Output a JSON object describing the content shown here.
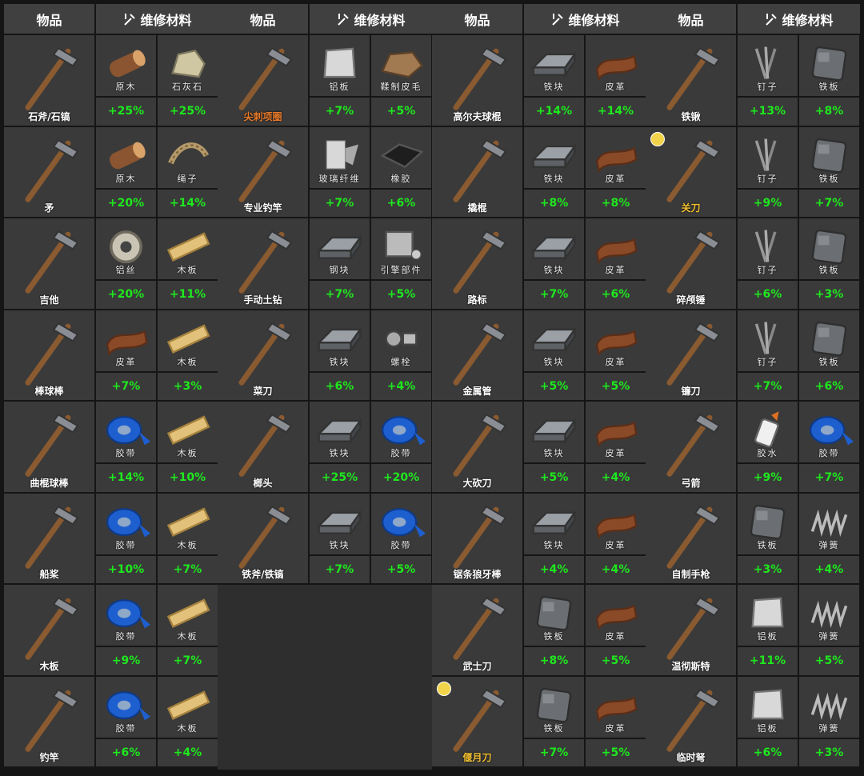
{
  "headers": {
    "item": "物品",
    "repair": "维修材料"
  },
  "columns": [
    [
      {
        "name": "石斧/石镐",
        "icon": "stone-axe-pickaxe-icon",
        "mats": [
          {
            "name": "原木",
            "pct": "+25%",
            "icon": "log-icon"
          },
          {
            "name": "石灰石",
            "pct": "+25%",
            "icon": "limestone-icon"
          }
        ]
      },
      {
        "name": "矛",
        "icon": "spear-icon",
        "mats": [
          {
            "name": "原木",
            "pct": "+20%",
            "icon": "log-icon"
          },
          {
            "name": "绳子",
            "pct": "+14%",
            "icon": "rope-icon"
          }
        ]
      },
      {
        "name": "吉他",
        "icon": "guitar-icon",
        "mats": [
          {
            "name": "铝丝",
            "pct": "+20%",
            "icon": "wire-icon"
          },
          {
            "name": "木板",
            "pct": "+11%",
            "icon": "plank-icon"
          }
        ]
      },
      {
        "name": "棒球棒",
        "icon": "baseball-bat-icon",
        "mats": [
          {
            "name": "皮革",
            "pct": "+7%",
            "icon": "leather-icon"
          },
          {
            "name": "木板",
            "pct": "+3%",
            "icon": "plank-icon"
          }
        ]
      },
      {
        "name": "曲棍球棒",
        "icon": "hockey-stick-icon",
        "mats": [
          {
            "name": "胶带",
            "pct": "+14%",
            "icon": "tape-icon"
          },
          {
            "name": "木板",
            "pct": "+10%",
            "icon": "plank-icon"
          }
        ]
      },
      {
        "name": "船桨",
        "icon": "paddle-icon",
        "mats": [
          {
            "name": "胶带",
            "pct": "+10%",
            "icon": "tape-icon"
          },
          {
            "name": "木板",
            "pct": "+7%",
            "icon": "plank-icon"
          }
        ]
      },
      {
        "name": "木板",
        "icon": "wooden-plank-weapon-icon",
        "mats": [
          {
            "name": "胶带",
            "pct": "+9%",
            "icon": "tape-icon"
          },
          {
            "name": "木板",
            "pct": "+7%",
            "icon": "plank-icon"
          }
        ]
      },
      {
        "name": "钓竿",
        "icon": "fishing-rod-icon",
        "mats": [
          {
            "name": "胶带",
            "pct": "+6%",
            "icon": "tape-icon"
          },
          {
            "name": "木板",
            "pct": "+4%",
            "icon": "plank-icon"
          }
        ]
      }
    ],
    [
      {
        "name": "尖刺项圈",
        "nameColor": "orange",
        "icon": "spiked-collar-icon",
        "mats": [
          {
            "name": "铝板",
            "pct": "+7%",
            "icon": "aluminum-sheet-icon"
          },
          {
            "name": "鞣制皮毛",
            "pct": "+5%",
            "icon": "tanned-fur-icon"
          }
        ]
      },
      {
        "name": "专业钓竿",
        "icon": "pro-fishing-rod-icon",
        "mats": [
          {
            "name": "玻璃纤维",
            "pct": "+7%",
            "icon": "fiberglass-icon"
          },
          {
            "name": "橡胶",
            "pct": "+6%",
            "icon": "rubber-icon"
          }
        ]
      },
      {
        "name": "手动土钻",
        "icon": "auger-icon",
        "mats": [
          {
            "name": "钢块",
            "pct": "+7%",
            "icon": "steel-ingot-icon"
          },
          {
            "name": "引擎部件",
            "pct": "+5%",
            "icon": "engine-part-icon"
          }
        ]
      },
      {
        "name": "菜刀",
        "icon": "cleaver-icon",
        "mats": [
          {
            "name": "铁块",
            "pct": "+6%",
            "icon": "iron-ingot-icon"
          },
          {
            "name": "螺栓",
            "pct": "+4%",
            "icon": "bolt-icon"
          }
        ]
      },
      {
        "name": "榔头",
        "icon": "hammer-icon",
        "mats": [
          {
            "name": "铁块",
            "pct": "+25%",
            "icon": "iron-ingot-icon"
          },
          {
            "name": "胶带",
            "pct": "+20%",
            "icon": "tape-icon"
          }
        ]
      },
      {
        "name": "铁斧/铁镐",
        "icon": "iron-axe-pickaxe-icon",
        "mats": [
          {
            "name": "铁块",
            "pct": "+7%",
            "icon": "iron-ingot-icon"
          },
          {
            "name": "胶带",
            "pct": "+5%",
            "icon": "tape-icon"
          }
        ]
      }
    ],
    [
      {
        "name": "高尔夫球棍",
        "icon": "golf-club-icon",
        "mats": [
          {
            "name": "铁块",
            "pct": "+14%",
            "icon": "iron-ingot-icon"
          },
          {
            "name": "皮革",
            "pct": "+14%",
            "icon": "leather-icon"
          }
        ]
      },
      {
        "name": "撬棍",
        "icon": "crowbar-icon",
        "mats": [
          {
            "name": "铁块",
            "pct": "+8%",
            "icon": "iron-ingot-icon"
          },
          {
            "name": "皮革",
            "pct": "+8%",
            "icon": "leather-icon"
          }
        ]
      },
      {
        "name": "路标",
        "icon": "road-sign-icon",
        "mats": [
          {
            "name": "铁块",
            "pct": "+7%",
            "icon": "iron-ingot-icon"
          },
          {
            "name": "皮革",
            "pct": "+6%",
            "icon": "leather-icon"
          }
        ]
      },
      {
        "name": "金属管",
        "icon": "metal-pipe-icon",
        "mats": [
          {
            "name": "铁块",
            "pct": "+5%",
            "icon": "iron-ingot-icon"
          },
          {
            "name": "皮革",
            "pct": "+5%",
            "icon": "leather-icon"
          }
        ]
      },
      {
        "name": "大砍刀",
        "icon": "machete-icon",
        "mats": [
          {
            "name": "铁块",
            "pct": "+5%",
            "icon": "iron-ingot-icon"
          },
          {
            "name": "皮革",
            "pct": "+4%",
            "icon": "leather-icon"
          }
        ]
      },
      {
        "name": "锯条狼牙棒",
        "icon": "saw-mace-icon",
        "mats": [
          {
            "name": "铁块",
            "pct": "+4%",
            "icon": "iron-ingot-icon"
          },
          {
            "name": "皮革",
            "pct": "+4%",
            "icon": "leather-icon"
          }
        ]
      },
      {
        "name": "武士刀",
        "icon": "katana-icon",
        "mats": [
          {
            "name": "铁板",
            "pct": "+8%",
            "icon": "iron-sheet-icon"
          },
          {
            "name": "皮革",
            "pct": "+5%",
            "icon": "leather-icon"
          }
        ]
      },
      {
        "name": "偃月刀",
        "nameColor": "gold",
        "badge": true,
        "icon": "crescent-blade-icon",
        "mats": [
          {
            "name": "铁板",
            "pct": "+7%",
            "icon": "iron-sheet-icon"
          },
          {
            "name": "皮革",
            "pct": "+5%",
            "icon": "leather-icon"
          }
        ]
      }
    ],
    [
      {
        "name": "铁锹",
        "icon": "shovel-icon",
        "mats": [
          {
            "name": "钉子",
            "pct": "+13%",
            "icon": "nails-icon"
          },
          {
            "name": "铁板",
            "pct": "+8%",
            "icon": "iron-sheet-icon"
          }
        ]
      },
      {
        "name": "关刀",
        "nameColor": "gold",
        "badge": true,
        "icon": "guandao-icon",
        "mats": [
          {
            "name": "钉子",
            "pct": "+9%",
            "icon": "nails-icon"
          },
          {
            "name": "铁板",
            "pct": "+7%",
            "icon": "iron-sheet-icon"
          }
        ]
      },
      {
        "name": "碎颅锤",
        "icon": "sledgehammer-icon",
        "mats": [
          {
            "name": "钉子",
            "pct": "+6%",
            "icon": "nails-icon"
          },
          {
            "name": "铁板",
            "pct": "+3%",
            "icon": "iron-sheet-icon"
          }
        ]
      },
      {
        "name": "镰刀",
        "icon": "scythe-icon",
        "mats": [
          {
            "name": "钉子",
            "pct": "+7%",
            "icon": "nails-icon"
          },
          {
            "name": "铁板",
            "pct": "+6%",
            "icon": "iron-sheet-icon"
          }
        ]
      },
      {
        "name": "弓箭",
        "icon": "bow-icon",
        "mats": [
          {
            "name": "胶水",
            "pct": "+9%",
            "icon": "glue-icon"
          },
          {
            "name": "胶带",
            "pct": "+7%",
            "icon": "tape-icon"
          }
        ]
      },
      {
        "name": "自制手枪",
        "icon": "homemade-pistol-icon",
        "mats": [
          {
            "name": "铁板",
            "pct": "+3%",
            "icon": "iron-sheet-icon"
          },
          {
            "name": "弹簧",
            "pct": "+4%",
            "icon": "spring-icon"
          }
        ]
      },
      {
        "name": "温彻斯特",
        "icon": "winchester-icon",
        "mats": [
          {
            "name": "铝板",
            "pct": "+11%",
            "icon": "aluminum-sheet-icon"
          },
          {
            "name": "弹簧",
            "pct": "+5%",
            "icon": "spring-icon"
          }
        ]
      },
      {
        "name": "临时弩",
        "icon": "crossbow-icon",
        "mats": [
          {
            "name": "铝板",
            "pct": "+6%",
            "icon": "aluminum-sheet-icon"
          },
          {
            "name": "弹簧",
            "pct": "+3%",
            "icon": "spring-icon"
          }
        ]
      }
    ]
  ]
}
